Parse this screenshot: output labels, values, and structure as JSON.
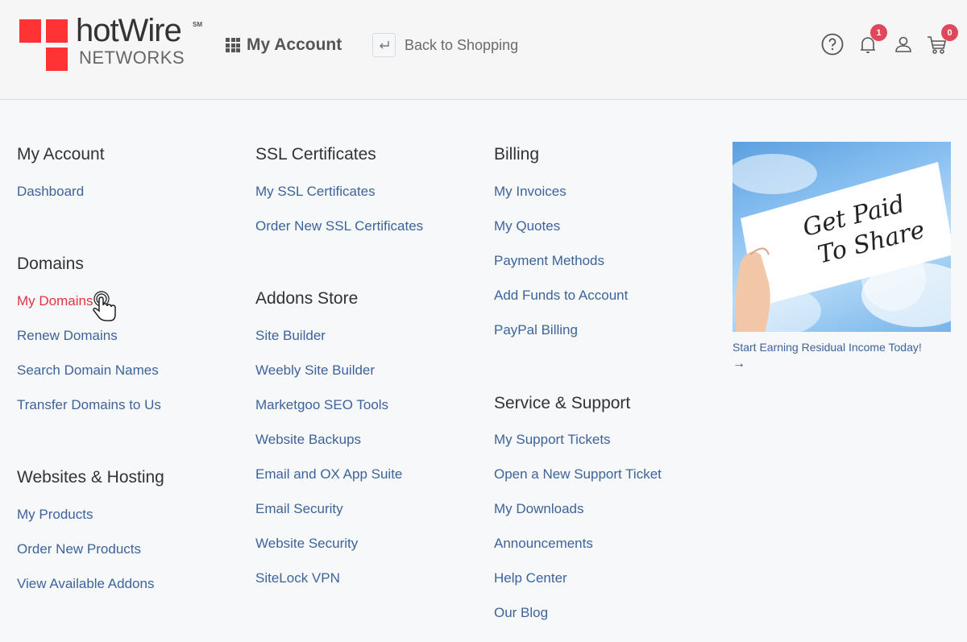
{
  "header": {
    "logo": {
      "brand": "hotWire",
      "trademark": "SM",
      "subtitle": "NETWORKS"
    },
    "my_account_label": "My Account",
    "back_to_shopping_label": "Back to Shopping",
    "notifications_count": "1",
    "cart_count": "0",
    "icons": [
      "help-icon",
      "bell-icon",
      "user-icon",
      "cart-icon"
    ],
    "colors": {
      "logo_red": "#ff3333",
      "badge": "#e0475b"
    }
  },
  "menu": {
    "my_account": {
      "title": "My Account",
      "links": [
        "Dashboard"
      ]
    },
    "domains": {
      "title": "Domains",
      "links": [
        "My Domains",
        "Renew Domains",
        "Search Domain Names",
        "Transfer Domains to Us"
      ],
      "active_link": "My Domains"
    },
    "websites_hosting": {
      "title": "Websites & Hosting",
      "links": [
        "My Products",
        "Order New Products",
        "View Available Addons"
      ]
    },
    "ssl": {
      "title": "SSL Certificates",
      "links": [
        "My SSL Certificates",
        "Order New SSL Certificates"
      ]
    },
    "addons": {
      "title": "Addons Store",
      "links": [
        "Site Builder",
        "Weebly Site Builder",
        "Marketgoo SEO Tools",
        "Website Backups",
        "Email and OX App Suite",
        "Email Security",
        "Website Security",
        "SiteLock VPN"
      ]
    },
    "billing": {
      "title": "Billing",
      "links": [
        "My Invoices",
        "My Quotes",
        "Payment Methods",
        "Add Funds to Account",
        "PayPal Billing"
      ]
    },
    "support": {
      "title": "Service & Support",
      "links": [
        "My Support Tickets",
        "Open a New Support Ticket",
        "My Downloads",
        "Announcements",
        "Help Center",
        "Our Blog"
      ]
    }
  },
  "promo": {
    "image_text_line1": "Get Paid",
    "image_text_line2": "To Share",
    "caption": "Start Earning Residual Income Today!",
    "arrow": "→"
  },
  "colors": {
    "link": "#3c639a",
    "link_active": "#e2343f",
    "heading": "#333333"
  }
}
